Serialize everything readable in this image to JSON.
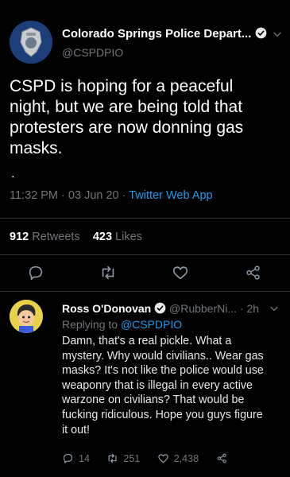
{
  "tweet": {
    "author_name": "Colorado Springs Police Depart...",
    "author_handle": "@CSPDPIO",
    "text": "CSPD is hoping for a peaceful\nnight, but we are being told that\nprotesters are now donning gas\nmasks.",
    "trailing_dot": ".",
    "time": "11:32 PM",
    "date": "03 Jun 20",
    "source": "Twitter Web App",
    "retweets_count": "912",
    "retweets_label": "Retweets",
    "likes_count": "423",
    "likes_label": "Likes"
  },
  "reply": {
    "author_name": "Ross O'Donovan",
    "author_handle": "@RubberNi...",
    "age": "2h",
    "replying_prefix": "Replying to",
    "replying_handle": "@CSPDPIO",
    "text": "Damn, that's a real pickle. What a\nmystery. Why would civilians.. Wear gas\nmasks? It's not like the police would use\nweaponry that is illegal in every active\nwarzone on civilians? That would be\nfucking ridiculous. Hope you guys figure\nit out!",
    "reply_count": "14",
    "retweet_count": "251",
    "like_count": "2,438"
  },
  "icons": {
    "verified": "verified-badge-icon",
    "chevron": "chevron-down-icon",
    "reply": "reply-icon",
    "retweet": "retweet-icon",
    "like": "heart-icon",
    "share": "share-icon"
  },
  "colors": {
    "background": "#000000",
    "text": "#e7e9ea",
    "muted": "#71767b",
    "link": "#1d9bf0",
    "divider": "#2f3336"
  }
}
